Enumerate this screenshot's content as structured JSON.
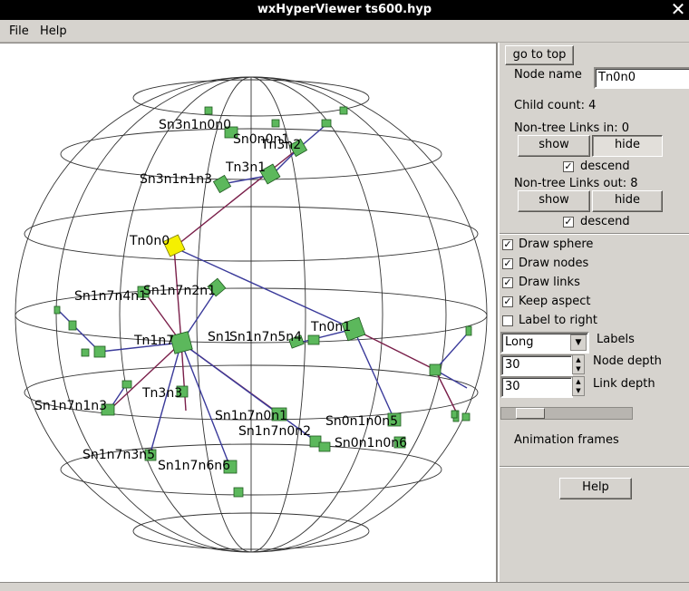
{
  "window": {
    "title": "wxHyperViewer ts600.hyp",
    "close": "✕"
  },
  "menubar": {
    "file": "File",
    "help": "Help"
  },
  "graph": {
    "labels": [
      "Sn3n1n0n0",
      "Sn0n0n1",
      "Tn3n2",
      "Tn3n1",
      "Sn3n1n1n3",
      "Tn0n0",
      "Sn1n7n4n1",
      "Sn1n7n2n1",
      "Tn1n7",
      "Sn1",
      "Sn1n7n5n4",
      "Tn0n1",
      "Tn3n3",
      "Sn1n7n1n3",
      "Sn1n7n0n1",
      "Sn1n7n0n2",
      "Sn0n1n0n5",
      "Sn0n1n0n6",
      "Sn1n7n3n5",
      "Sn1n7n6n6"
    ],
    "colors": {
      "node": "#5cb85c",
      "selected": "#f5f000",
      "link_tree": "#7a1f4a",
      "link_blue": "#3a3a9a",
      "grid": "#333333"
    }
  },
  "panel": {
    "go_to_top": "go to top",
    "node_name_label": "Node name",
    "node_name_value": "Tn0n0",
    "child_count": "Child count:  4",
    "links_in": "Non-tree Links in:  0",
    "show": "show",
    "hide": "hide",
    "descend": "descend",
    "links_out": "Non-tree Links out:  8",
    "draw_sphere": "Draw sphere",
    "draw_nodes": "Draw nodes",
    "draw_links": "Draw links",
    "keep_aspect": "Keep aspect",
    "label_to_right": "Label to right",
    "labels_value": "Long",
    "labels_label": "Labels",
    "node_depth_value": "30",
    "node_depth_label": "Node depth",
    "link_depth_value": "30",
    "link_depth_label": "Link depth",
    "animation_frames_label": "Animation frames",
    "animation_frames_value": 0.05,
    "help": "Help"
  }
}
